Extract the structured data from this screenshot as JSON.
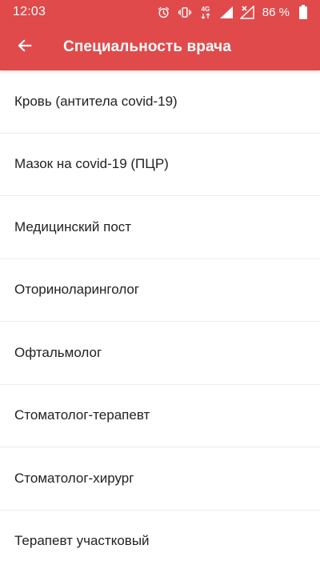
{
  "status_bar": {
    "time": "12:03",
    "network_label": "4G",
    "battery_percent": "86 %",
    "icons": [
      "alarm-icon",
      "vibrate-icon",
      "network-4g-icon",
      "signal-icon",
      "no-signal-icon",
      "battery-icon"
    ]
  },
  "app_bar": {
    "back_icon": "arrow-left-icon",
    "title": "Специальность врача"
  },
  "specialties": [
    {
      "label": "Кровь (антитела covid-19)"
    },
    {
      "label": "Мазок на covid-19 (ПЦР)"
    },
    {
      "label": "Медицинский пост"
    },
    {
      "label": "Оториноларинголог"
    },
    {
      "label": "Офтальмолог"
    },
    {
      "label": "Стоматолог-терапевт"
    },
    {
      "label": "Стоматолог-хирург"
    },
    {
      "label": "Терапевт участковый"
    }
  ],
  "colors": {
    "primary": "#e04a4b",
    "text": "#222222",
    "divider": "#ececec"
  }
}
